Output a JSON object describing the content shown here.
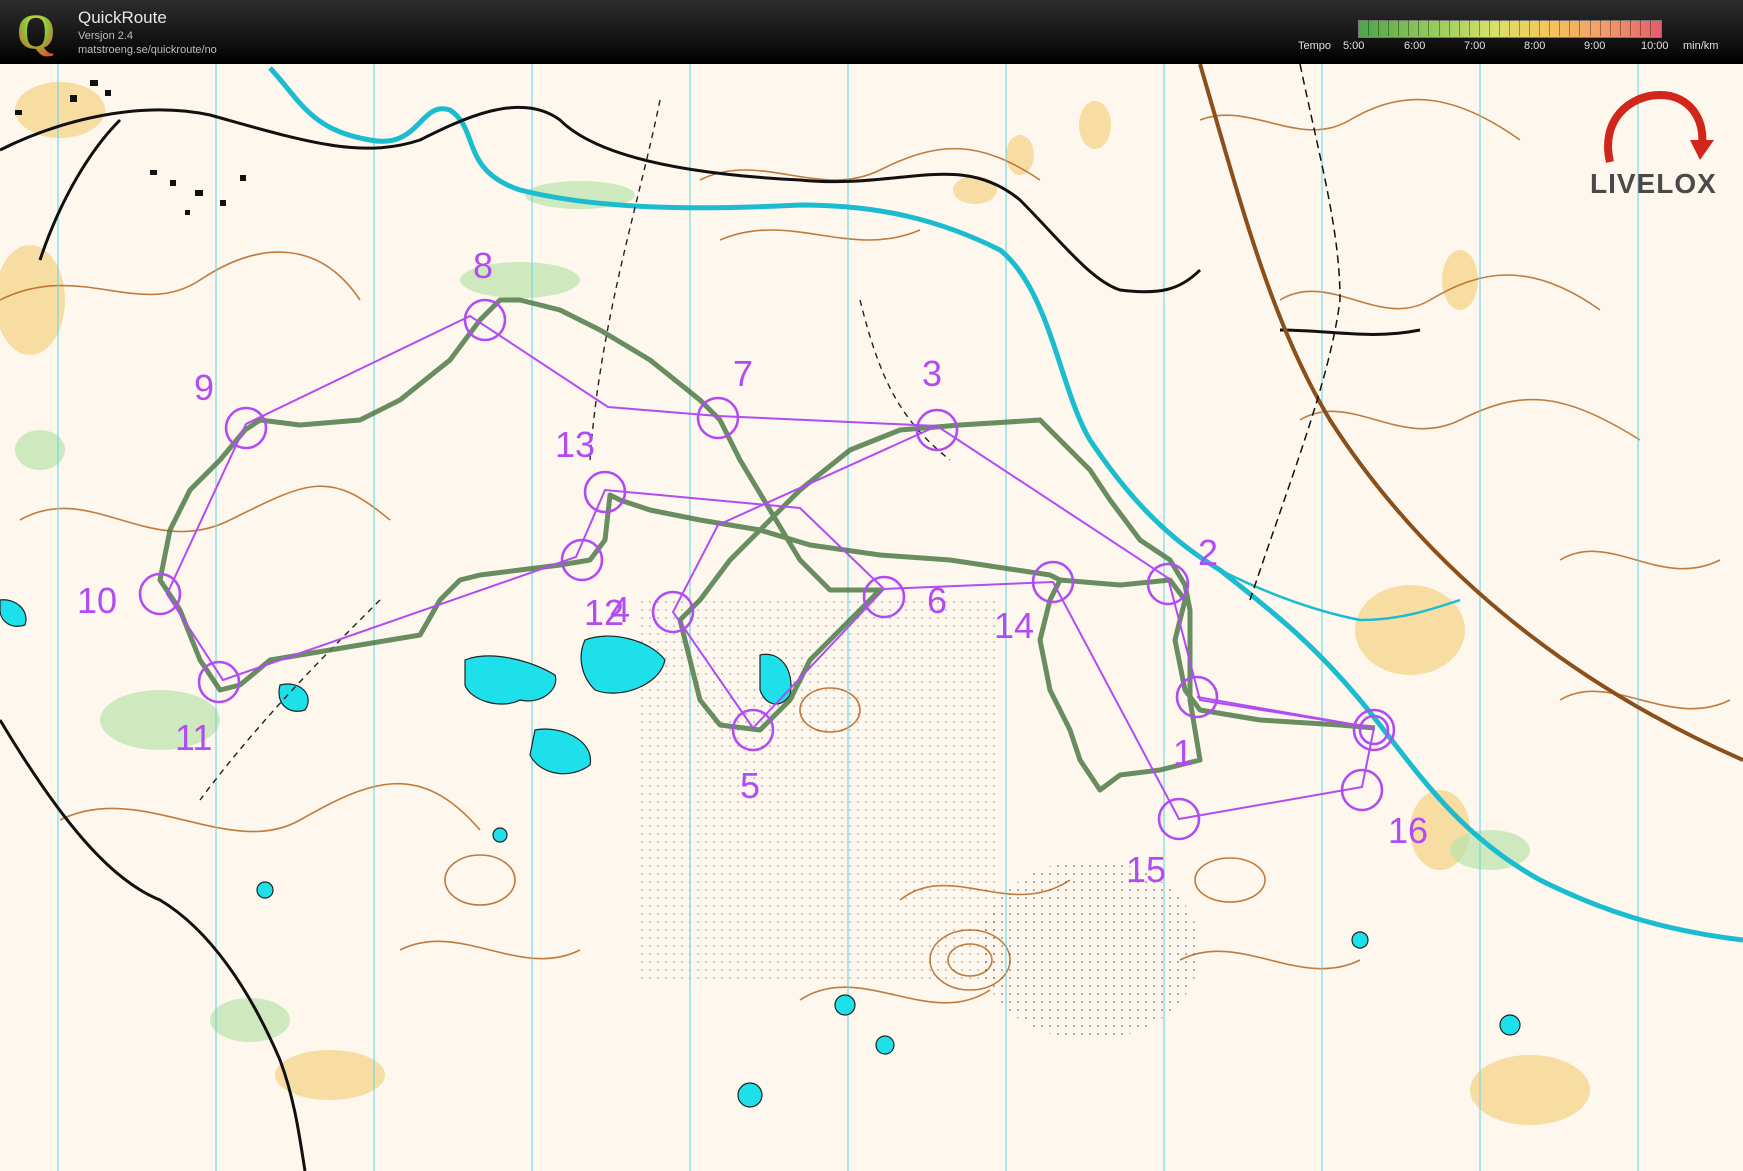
{
  "header": {
    "app_title": "QuickRoute",
    "version": "Versjon 2.4",
    "url": "matstroeng.se/quickroute/no",
    "tempo_label": "Tempo",
    "tempo_values": [
      "5:00",
      "6:00",
      "7:00",
      "8:00",
      "9:00",
      "10:00"
    ],
    "tempo_unit": "min/km",
    "tempo_gradient": [
      "#4fa34b",
      "#8dc85a",
      "#d8e26a",
      "#f4c65a",
      "#f39a6b",
      "#e35d6a"
    ]
  },
  "watermark": {
    "text": "LIVELOX",
    "icon": "livelox-arrow-icon"
  },
  "map": {
    "course_color": "#b24bf3",
    "route_color": "#4d7a47",
    "control_labels": [
      "1",
      "2",
      "3",
      "4",
      "5",
      "6",
      "7",
      "8",
      "9",
      "10",
      "11",
      "12",
      "13",
      "14",
      "15",
      "16"
    ]
  }
}
